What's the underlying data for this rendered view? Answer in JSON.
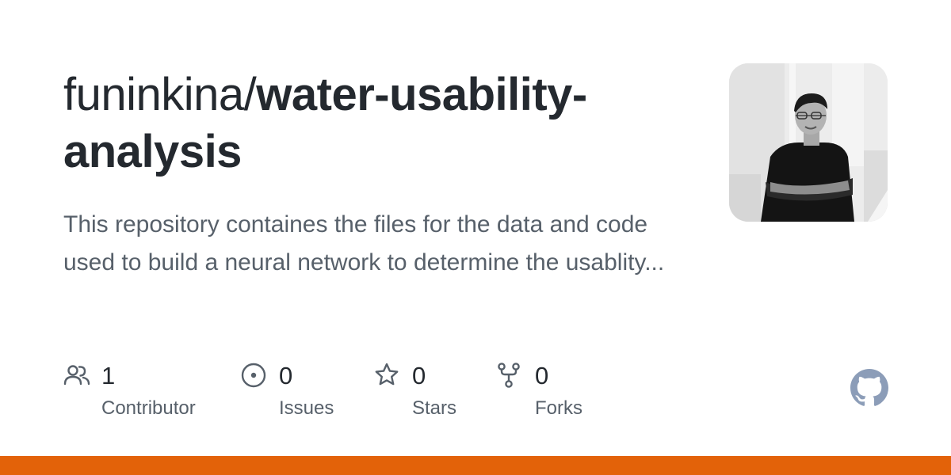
{
  "repo": {
    "owner": "funinkina/",
    "name": "water-usability-analysis",
    "description": "This repository containes the files for the data and code used to build a neural network to determine the usablity..."
  },
  "stats": {
    "contributors": {
      "count": "1",
      "label": "Contributor",
      "icon": "people-icon"
    },
    "issues": {
      "count": "0",
      "label": "Issues",
      "icon": "issue-opened-icon"
    },
    "stars": {
      "count": "0",
      "label": "Stars",
      "icon": "star-icon"
    },
    "forks": {
      "count": "0",
      "label": "Forks",
      "icon": "repo-forked-icon"
    }
  },
  "icons": {
    "brand": "github-mark-icon",
    "avatar": "owner-avatar"
  },
  "colors": {
    "title": "#24292f",
    "muted": "#57606a",
    "icon": "#57606a",
    "github_logo": "#8c9db8",
    "language_bar": "#e36209"
  }
}
